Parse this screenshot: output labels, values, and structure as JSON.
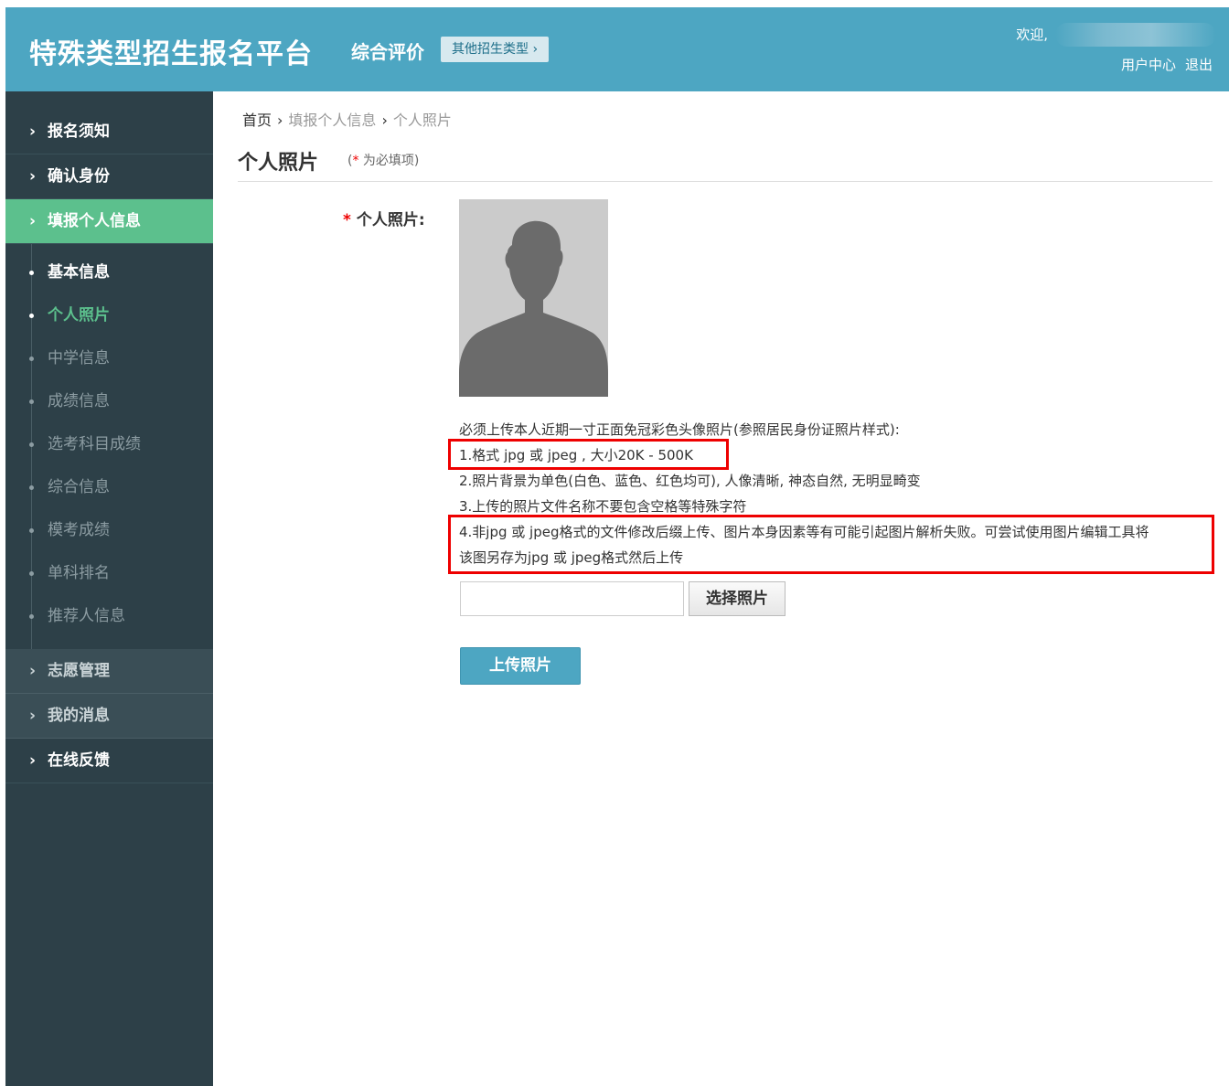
{
  "header": {
    "title": "特殊类型招生报名平台",
    "subtitle": "综合评价",
    "other_types_button": "其他招生类型 ›",
    "welcome": "欢迎,",
    "user_center": "用户中心",
    "logout": "退出",
    "brand_color": "#4da6c2"
  },
  "sidebar": {
    "items_top": [
      {
        "label": "报名须知"
      },
      {
        "label": "确认身份"
      },
      {
        "label": "填报个人信息"
      }
    ],
    "sub_items": [
      {
        "label": "基本信息",
        "state": "done"
      },
      {
        "label": "个人照片",
        "state": "current"
      },
      {
        "label": "中学信息",
        "state": "todo"
      },
      {
        "label": "成绩信息",
        "state": "todo"
      },
      {
        "label": "选考科目成绩",
        "state": "todo"
      },
      {
        "label": "综合信息",
        "state": "todo"
      },
      {
        "label": "模考成绩",
        "state": "todo"
      },
      {
        "label": "单科排名",
        "state": "todo"
      },
      {
        "label": "推荐人信息",
        "state": "todo"
      }
    ],
    "items_bottom": [
      {
        "label": "志愿管理"
      },
      {
        "label": "我的消息"
      },
      {
        "label": "在线反馈"
      }
    ],
    "chevron": "›",
    "active_color": "#5cc08d"
  },
  "breadcrumb": {
    "home": "首页",
    "sep": "›",
    "level2": "填报个人信息",
    "level3": "个人照片"
  },
  "page": {
    "title": "个人照片",
    "required_note_open": "(",
    "required_star": "*",
    "required_note_text": " 为必填项)"
  },
  "form": {
    "photo_label_star": "*",
    "photo_label": "个人照片:",
    "photo_icon": "person-silhouette-icon",
    "notes": [
      "必须上传本人近期一寸正面免冠彩色头像照片(参照居民身份证照片样式):",
      "1.格式 jpg 或 jpeg ,  大小20K - 500K",
      "2.照片背景为单色(白色、蓝色、红色均可), 人像清晰, 神态自然, 无明显畸变",
      "3.上传的照片文件名称不要包含空格等特殊字符",
      "4.非jpg 或 jpeg格式的文件修改后缀上传、图片本身因素等有可能引起图片解析失败。可尝试使用图片编辑工具将",
      "该图另存为jpg 或 jpeg格式然后上传"
    ],
    "file_value": "",
    "choose_button": "选择照片",
    "upload_button": "上传照片",
    "highlight_color": "#ee0000"
  }
}
